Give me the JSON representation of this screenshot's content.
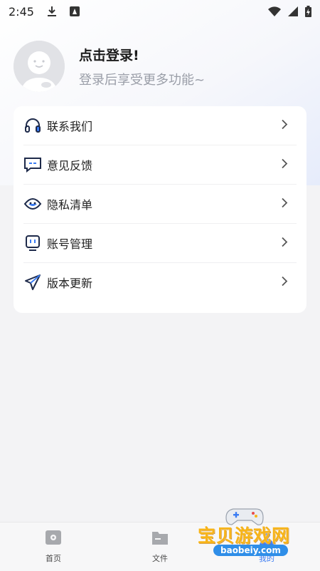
{
  "status_bar": {
    "time": "2:45"
  },
  "profile": {
    "title": "点击登录!",
    "subtitle": "登录后享受更多功能~"
  },
  "menu": {
    "items": [
      {
        "label": "联系我们",
        "icon": "headset-icon"
      },
      {
        "label": "意见反馈",
        "icon": "feedback-icon"
      },
      {
        "label": "隐私清单",
        "icon": "privacy-icon"
      },
      {
        "label": "账号管理",
        "icon": "account-icon"
      },
      {
        "label": "版本更新",
        "icon": "send-icon"
      }
    ]
  },
  "bottom_nav": {
    "tabs": [
      {
        "label": "首页",
        "icon": "home-icon"
      },
      {
        "label": "文件",
        "icon": "folder-icon"
      },
      {
        "label": "我的",
        "icon": "profile-icon",
        "active": true
      }
    ]
  },
  "watermark": {
    "text": "宝贝游戏网",
    "domain": "baobeiy.com"
  },
  "colors": {
    "accent": "#3b7cf3",
    "icon_dark": "#1e2a4a",
    "card": "#ffffff"
  }
}
